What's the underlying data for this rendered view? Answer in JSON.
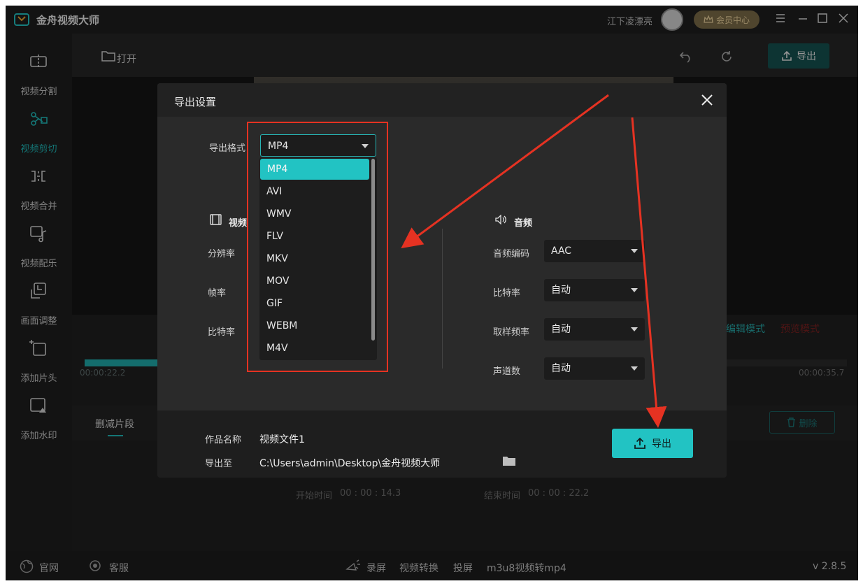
{
  "app": {
    "title": "金舟视频大师",
    "username": "江下凌漂亮",
    "vip_label": "会员中心",
    "version": "v 2.8.5"
  },
  "sidebar": {
    "items": [
      {
        "label": "视频分割",
        "icon": "split-icon"
      },
      {
        "label": "视频剪切",
        "icon": "scissors-icon",
        "active": true
      },
      {
        "label": "视频合并",
        "icon": "merge-icon"
      },
      {
        "label": "视频配乐",
        "icon": "music-icon"
      },
      {
        "label": "画面调整",
        "icon": "crop-icon"
      },
      {
        "label": "添加片头",
        "icon": "intro-icon"
      },
      {
        "label": "添加水印",
        "icon": "watermark-icon"
      }
    ]
  },
  "toolbar": {
    "open_label": "打开",
    "export_label": "导出"
  },
  "editor": {
    "mode_edit": "编辑模式",
    "mode_preview": "预览模式",
    "time_current": "00:00:22.2",
    "time_total": "00:00:35.7",
    "cut_tab": "删减片段",
    "delete_label": "删除",
    "start_label": "开始时间",
    "start_value": "00 : 00 : 14.3",
    "end_label": "结束时间",
    "end_value": "00 : 00 : 22.2"
  },
  "footer": {
    "website": "官网",
    "service": "客服",
    "links": [
      "录屏",
      "视频转换",
      "投屏",
      "m3u8视频转mp4"
    ]
  },
  "dialog": {
    "title": "导出设置",
    "format_label": "导出格式",
    "format_value": "MP4",
    "format_options": [
      "MP4",
      "AVI",
      "WMV",
      "FLV",
      "MKV",
      "MOV",
      "GIF",
      "WEBM",
      "M4V"
    ],
    "video_section": "视频",
    "video_fields": [
      "分辨率",
      "帧率",
      "比特率"
    ],
    "audio_section": "音频",
    "audio_fields": [
      {
        "label": "音频编码",
        "value": "AAC"
      },
      {
        "label": "比特率",
        "value": "自动"
      },
      {
        "label": "取样频率",
        "value": "自动"
      },
      {
        "label": "声道数",
        "value": "自动"
      }
    ],
    "name_label": "作品名称",
    "name_value": "视频文件1",
    "path_label": "导出至",
    "path_value": "C:\\Users\\admin\\Desktop\\金舟视频大师",
    "export_label": "导出"
  },
  "colors": {
    "accent": "#22c3c3",
    "annotation": "#e53222"
  }
}
